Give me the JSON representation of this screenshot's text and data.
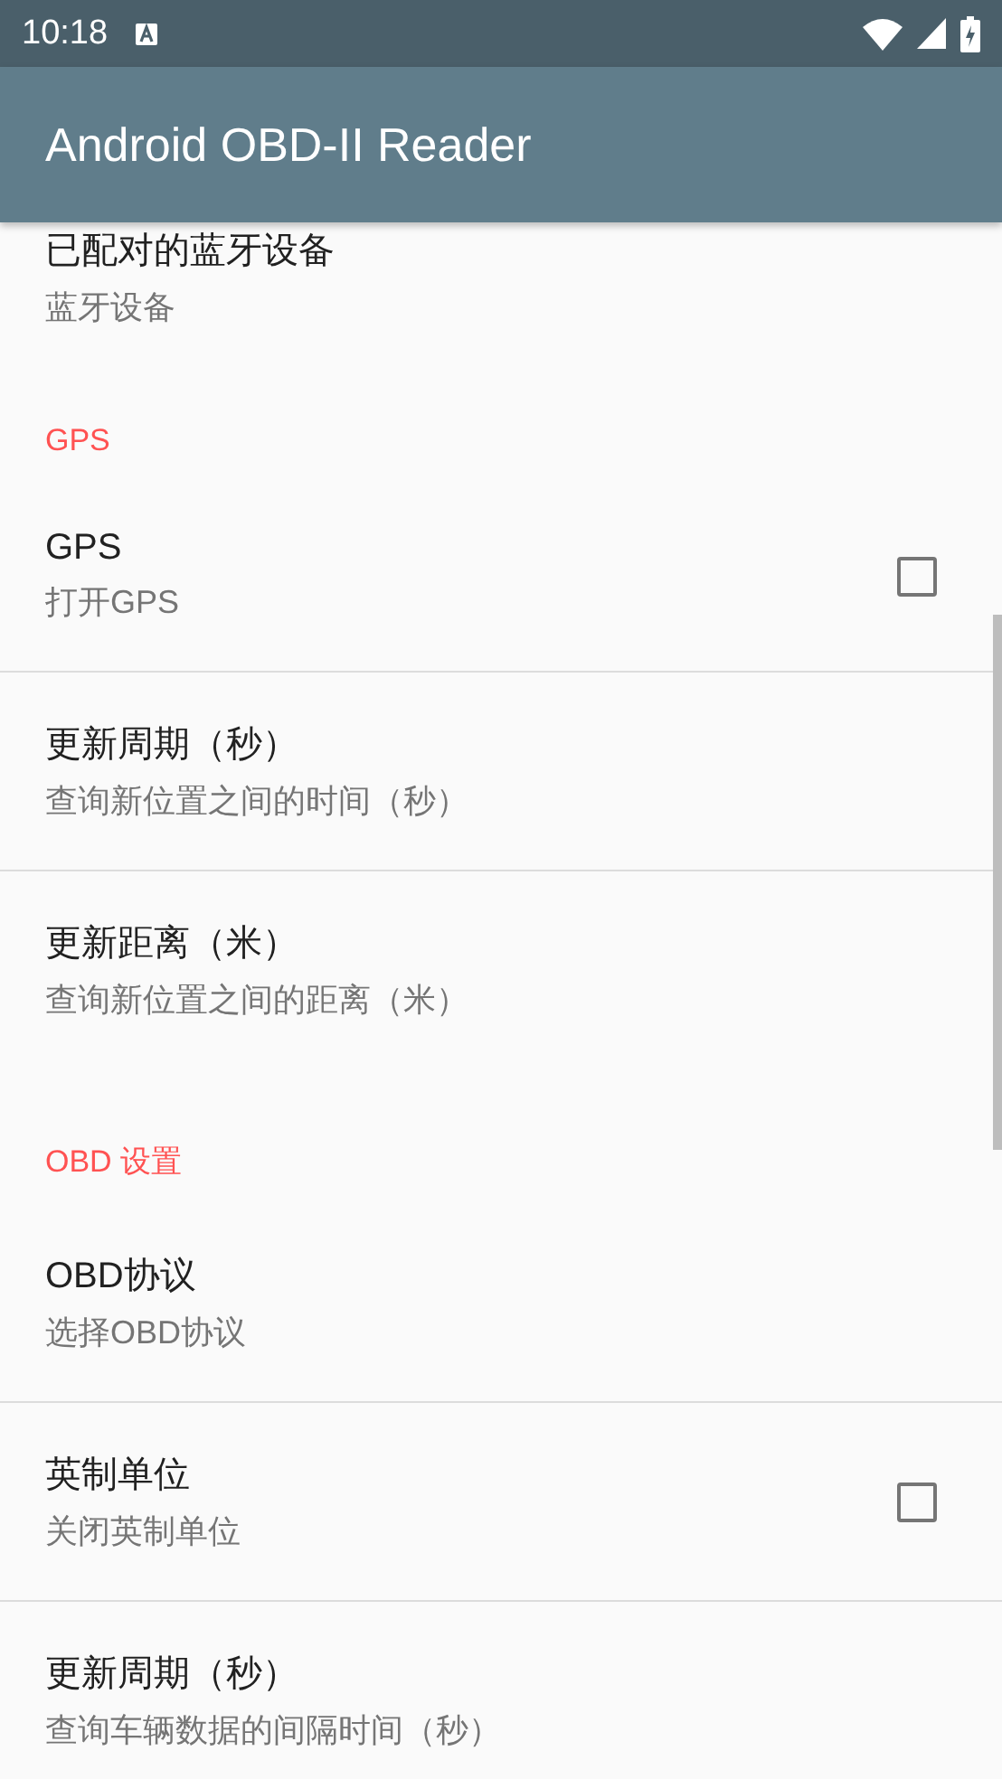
{
  "status_bar": {
    "time": "10:18"
  },
  "app_bar": {
    "title": "Android OBD-II Reader"
  },
  "sections": [
    {
      "items": [
        {
          "kind": "text",
          "title": "已配对的蓝牙设备",
          "summary": "蓝牙设备"
        }
      ]
    },
    {
      "header": "GPS",
      "items": [
        {
          "kind": "checkbox",
          "title": "GPS",
          "summary": "打开GPS",
          "checked": false
        },
        {
          "kind": "text",
          "title": "更新周期（秒）",
          "summary": "查询新位置之间的时间（秒）"
        },
        {
          "kind": "text",
          "title": "更新距离（米）",
          "summary": "查询新位置之间的距离（米）"
        }
      ]
    },
    {
      "header": "OBD 设置",
      "items": [
        {
          "kind": "text",
          "title": "OBD协议",
          "summary": "选择OBD协议"
        },
        {
          "kind": "checkbox",
          "title": "英制单位",
          "summary": "关闭英制单位",
          "checked": false
        },
        {
          "kind": "text",
          "title": "更新周期（秒）",
          "summary": "查询车辆数据的间隔时间（秒）"
        }
      ]
    }
  ]
}
